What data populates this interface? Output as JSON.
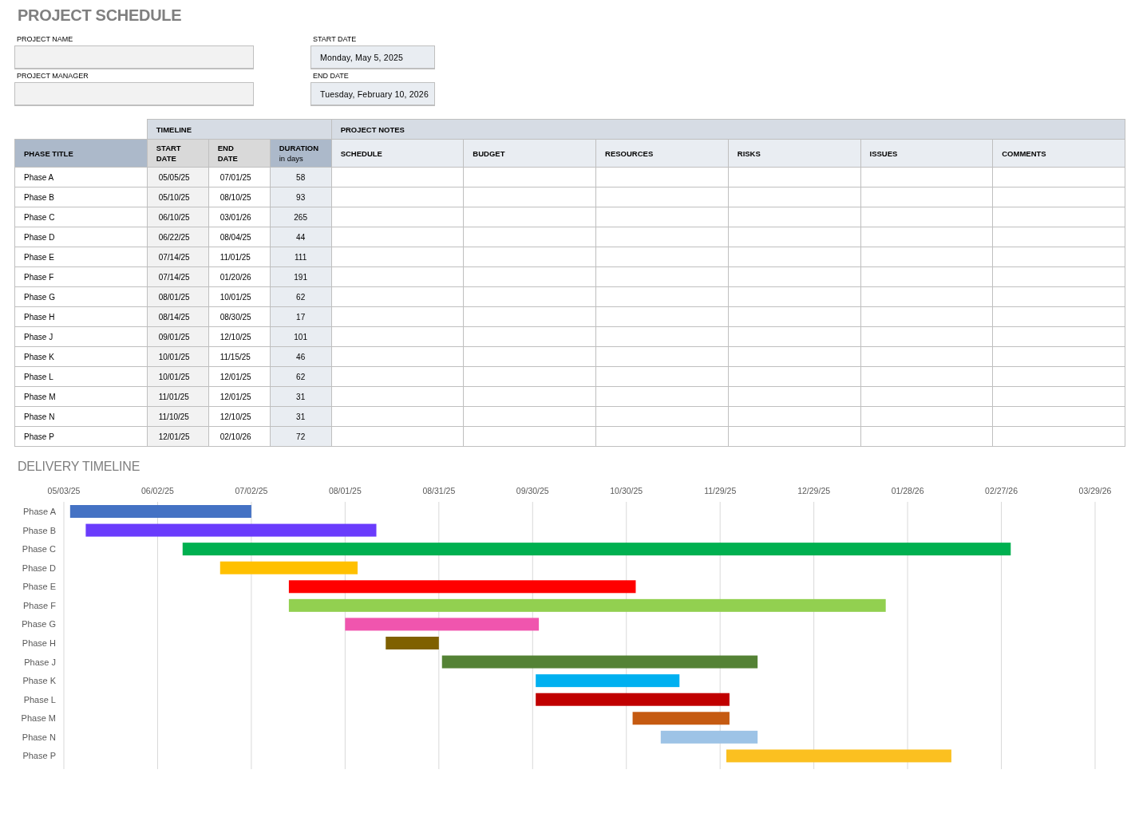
{
  "title": "PROJECT SCHEDULE",
  "project_name": {
    "label": "PROJECT NAME"
  },
  "start_date": {
    "label": "START DATE",
    "value": "Monday, May 5, 2025"
  },
  "project_manager": {
    "label": "PROJECT MANAGER"
  },
  "end_date": {
    "label": "END DATE",
    "value": "Tuesday, February 10, 2026"
  },
  "table": {
    "group_headers": [
      {
        "label": "TIMELINE",
        "kind": "timeline"
      },
      {
        "label": "PROJECT NOTES",
        "kind": "notes"
      }
    ],
    "columns": [
      {
        "label": "PHASE TITLE",
        "kind": "phase"
      },
      {
        "label": "START DATE",
        "kind": "start"
      },
      {
        "label": "END DATE",
        "kind": "end"
      },
      {
        "label": "DURATION",
        "sublabel": "in days",
        "kind": "duration"
      },
      {
        "label": "SCHEDULE",
        "kind": "note"
      },
      {
        "label": "BUDGET",
        "kind": "note"
      },
      {
        "label": "RESOURCES",
        "kind": "note"
      },
      {
        "label": "RISKS",
        "kind": "note"
      },
      {
        "label": "ISSUES",
        "kind": "note"
      },
      {
        "label": "COMMENTS",
        "kind": "note"
      }
    ],
    "rows": [
      [
        "Phase A",
        "05/05/25",
        "07/01/25",
        "58"
      ],
      [
        "Phase B",
        "05/10/25",
        "08/10/25",
        "93"
      ],
      [
        "Phase C",
        "06/10/25",
        "03/01/26",
        "265"
      ],
      [
        "Phase D",
        "06/22/25",
        "08/04/25",
        "44"
      ],
      [
        "Phase E",
        "07/14/25",
        "11/01/25",
        "111"
      ],
      [
        "Phase F",
        "07/14/25",
        "01/20/26",
        "191"
      ],
      [
        "Phase G",
        "08/01/25",
        "10/01/25",
        "62"
      ],
      [
        "Phase H",
        "08/14/25",
        "08/30/25",
        "17"
      ],
      [
        "Phase J",
        "09/01/25",
        "12/10/25",
        "101"
      ],
      [
        "Phase K",
        "10/01/25",
        "11/15/25",
        "46"
      ],
      [
        "Phase L",
        "10/01/25",
        "12/01/25",
        "62"
      ],
      [
        "Phase M",
        "11/01/25",
        "12/01/25",
        "31"
      ],
      [
        "Phase N",
        "11/10/25",
        "12/10/25",
        "31"
      ],
      [
        "Phase P",
        "12/01/25",
        "02/10/26",
        "72"
      ]
    ]
  },
  "delivery_timeline": {
    "title": "DELIVERY TIMELINE",
    "axis_labels": [
      "05/03/25",
      "06/02/25",
      "07/02/25",
      "08/01/25",
      "08/31/25",
      "09/30/25",
      "10/30/25",
      "11/29/25",
      "12/29/25",
      "01/28/26",
      "02/27/26",
      "03/29/26"
    ],
    "bars": [
      {
        "label": "Phase A",
        "color": "#4472c4"
      },
      {
        "label": "Phase B",
        "color": "#6a3cfc"
      },
      {
        "label": "Phase C",
        "color": "#00b050"
      },
      {
        "label": "Phase D",
        "color": "#ffc000"
      },
      {
        "label": "Phase E",
        "color": "#ff0000"
      },
      {
        "label": "Phase F",
        "color": "#92d050"
      },
      {
        "label": "Phase G",
        "color": "#f055ae"
      },
      {
        "label": "Phase H",
        "color": "#7f6000"
      },
      {
        "label": "Phase J",
        "color": "#548235"
      },
      {
        "label": "Phase K",
        "color": "#00b0f0"
      },
      {
        "label": "Phase L",
        "color": "#c00000"
      },
      {
        "label": "Phase M",
        "color": "#c55a11"
      },
      {
        "label": "Phase N",
        "color": "#9dc3e6"
      },
      {
        "label": "Phase P",
        "color": "#fbc020"
      }
    ]
  }
}
